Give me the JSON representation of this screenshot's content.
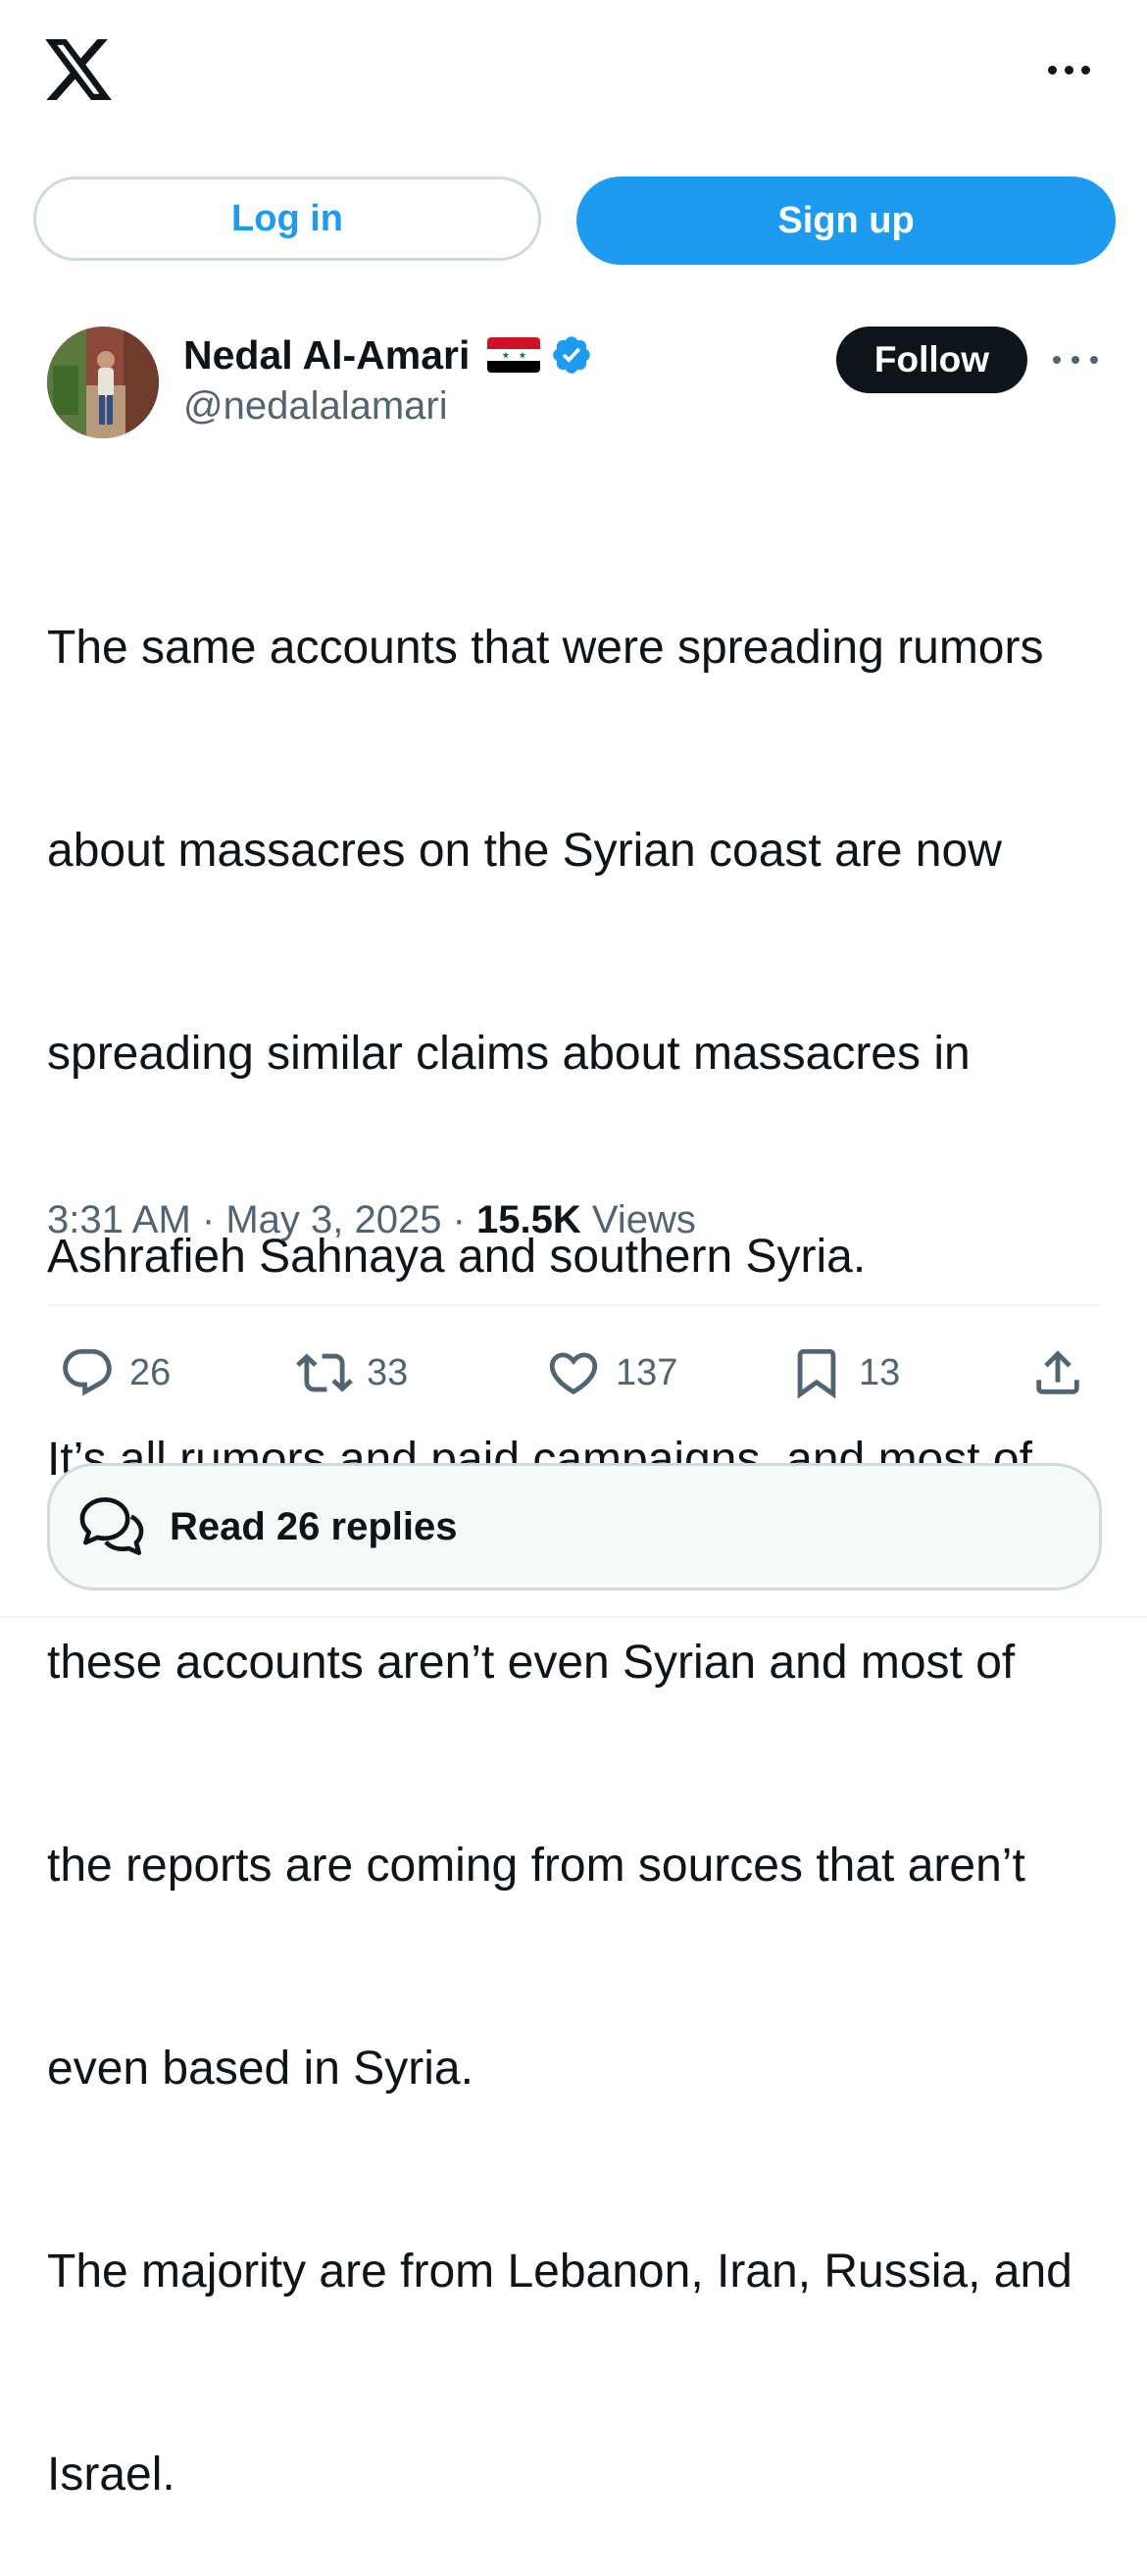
{
  "header": {
    "logo_icon": "x-logo-icon",
    "more_icon": "more-horizontal-icon"
  },
  "auth": {
    "login_label": "Log in",
    "signup_label": "Sign up"
  },
  "author": {
    "name": "Nedal Al-Amari",
    "flag": "syria-flag",
    "verified": true,
    "handle": "@nedalalamari",
    "follow_label": "Follow"
  },
  "tweet": {
    "lines": [
      "The same accounts that were spreading rumors",
      "about massacres on the Syrian coast are now",
      "spreading similar claims about massacres in",
      "Ashrafieh Sahnaya and southern Syria.",
      "It’s all rumors and paid campaigns, and most of",
      "these accounts aren’t even Syrian and most of",
      "the reports are coming from sources that aren’t",
      "even based in Syria.",
      "The majority are from Lebanon, Iran, Russia, and",
      "Israel."
    ],
    "time": "3:31 AM",
    "sep1": " · ",
    "date": "May 3, 2025",
    "sep2": " · ",
    "views_count": "15.5K",
    "views_label": " Views"
  },
  "actions": {
    "replies": "26",
    "reposts": "33",
    "likes": "137",
    "bookmarks": "13"
  },
  "read_replies_label": "Read 26 replies",
  "colors": {
    "accent": "#1d9bf0",
    "text": "#0f1419",
    "secondary": "#536471",
    "border": "#cfd9de"
  }
}
